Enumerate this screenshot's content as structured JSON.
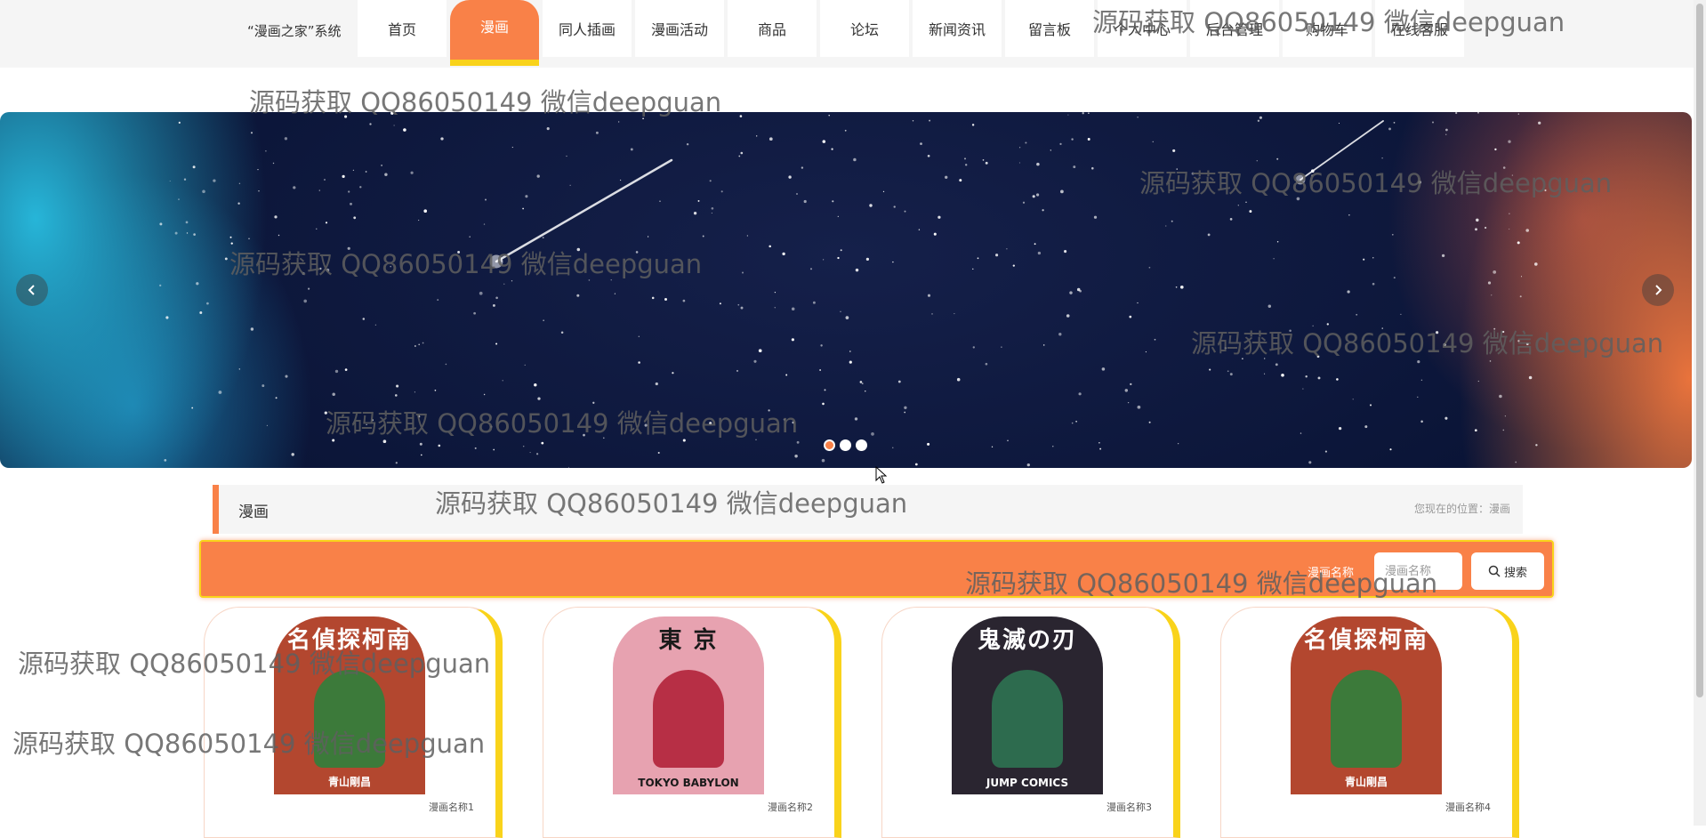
{
  "header": {
    "brand": "“漫画之家”系统",
    "nav": [
      {
        "label": "首页",
        "active": false
      },
      {
        "label": "漫画",
        "active": true
      },
      {
        "label": "同人插画",
        "active": false
      },
      {
        "label": "漫画活动",
        "active": false
      },
      {
        "label": "商品",
        "active": false
      },
      {
        "label": "论坛",
        "active": false
      },
      {
        "label": "新闻资讯",
        "active": false
      },
      {
        "label": "留言板",
        "active": false
      },
      {
        "label": "个人中心",
        "active": false
      },
      {
        "label": "后台管理",
        "active": false
      },
      {
        "label": "购物车",
        "active": false
      },
      {
        "label": "在线客服",
        "active": false
      }
    ]
  },
  "banner": {
    "slide_count": 3,
    "active_slide": 1,
    "prev_icon": "chevron-left-icon",
    "next_icon": "chevron-right-icon"
  },
  "section": {
    "title": "漫画",
    "breadcrumb": "您现在的位置：漫画"
  },
  "search": {
    "label": "漫画名称",
    "placeholder": "漫画名称",
    "value": "",
    "button_label": "搜索",
    "button_icon": "search-icon"
  },
  "comics": [
    {
      "name": "漫画名称1",
      "cover_title": "名偵探柯南",
      "cover_sub": "青山剛昌",
      "bg": "#b3472f",
      "title_color": "#ffffff",
      "fig": "#3c7a3a"
    },
    {
      "name": "漫画名称2",
      "cover_title": "東 京",
      "cover_sub": "TOKYO BABYLON",
      "bg": "#e7a2b0",
      "title_color": "#1a1a1a",
      "fig": "#b72f45"
    },
    {
      "name": "漫画名称3",
      "cover_title": "鬼滅の刃",
      "cover_sub": "JUMP COMICS",
      "bg": "#2a2530",
      "title_color": "#ffffff",
      "fig": "#2d6b4e"
    },
    {
      "name": "漫画名称4",
      "cover_title": "名偵探柯南",
      "cover_sub": "青山剛昌",
      "bg": "#b3472f",
      "title_color": "#ffffff",
      "fig": "#3c7a3a"
    }
  ],
  "watermark": "源码获取 QQ86050149 微信deepguan",
  "colors": {
    "accent": "#f98148",
    "accent_secondary": "#f9d31b",
    "nav_bg": "#f5f5f5"
  }
}
